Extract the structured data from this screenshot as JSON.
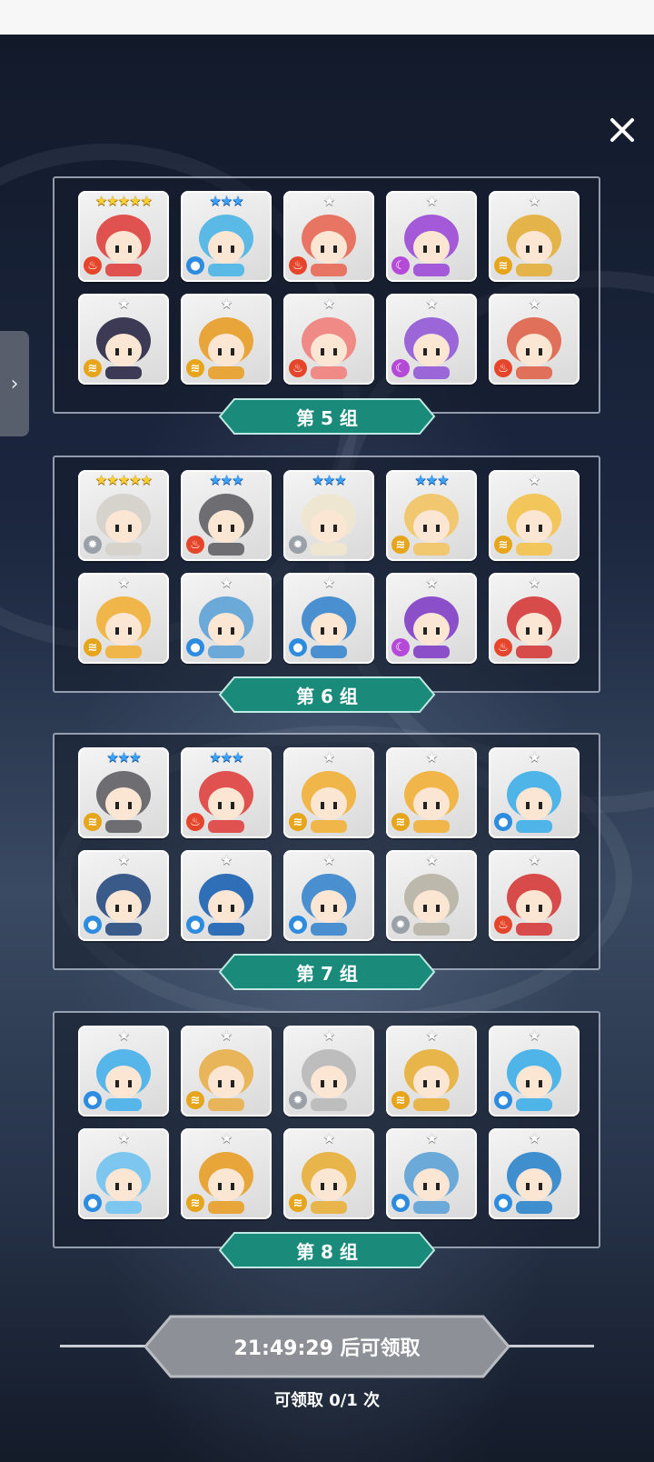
{
  "close_label": "✕",
  "side_tab_label": "›",
  "groups": [
    {
      "label": "第 5 组",
      "cards": [
        {
          "stars": "★★★★★",
          "tier": "gold",
          "element": "fire",
          "color": "#e0524f"
        },
        {
          "stars": "★★★",
          "tier": "blue",
          "element": "water",
          "color": "#5bb9e6"
        },
        {
          "stars": "★",
          "tier": "silver",
          "element": "fire",
          "color": "#e87564"
        },
        {
          "stars": "★",
          "tier": "silver",
          "element": "dark",
          "color": "#a45ad8"
        },
        {
          "stars": "★",
          "tier": "silver",
          "element": "wind",
          "color": "#e4b44b"
        },
        {
          "stars": "★",
          "tier": "silver",
          "element": "wind",
          "color": "#3c3a55"
        },
        {
          "stars": "★",
          "tier": "silver",
          "element": "wind",
          "color": "#e8a63a"
        },
        {
          "stars": "★",
          "tier": "silver",
          "element": "fire",
          "color": "#f08a86"
        },
        {
          "stars": "★",
          "tier": "silver",
          "element": "dark",
          "color": "#9a66d8"
        },
        {
          "stars": "★",
          "tier": "silver",
          "element": "fire",
          "color": "#e0705a"
        }
      ]
    },
    {
      "label": "第 6 组",
      "cards": [
        {
          "stars": "★★★★★",
          "tier": "gold",
          "element": "light",
          "color": "#d6d3cd"
        },
        {
          "stars": "★★★",
          "tier": "blue",
          "element": "fire",
          "color": "#6d6d72"
        },
        {
          "stars": "★★★",
          "tier": "blue",
          "element": "light",
          "color": "#efe6d2"
        },
        {
          "stars": "★★★",
          "tier": "blue",
          "element": "wind",
          "color": "#f1c870"
        },
        {
          "stars": "★",
          "tier": "silver",
          "element": "wind",
          "color": "#f2c65a"
        },
        {
          "stars": "★",
          "tier": "silver",
          "element": "wind",
          "color": "#f0b64a"
        },
        {
          "stars": "★",
          "tier": "silver",
          "element": "water",
          "color": "#6aa9d8"
        },
        {
          "stars": "★",
          "tier": "silver",
          "element": "water",
          "color": "#4a8fcf"
        },
        {
          "stars": "★",
          "tier": "silver",
          "element": "dark",
          "color": "#8b4fc9"
        },
        {
          "stars": "★",
          "tier": "silver",
          "element": "fire",
          "color": "#d84b4b"
        }
      ]
    },
    {
      "label": "第 7 组",
      "cards": [
        {
          "stars": "★★★",
          "tier": "blue",
          "element": "wind",
          "color": "#6d6d72"
        },
        {
          "stars": "★★★",
          "tier": "blue",
          "element": "fire",
          "color": "#e0524f"
        },
        {
          "stars": "★",
          "tier": "silver",
          "element": "wind",
          "color": "#f0b64a"
        },
        {
          "stars": "★",
          "tier": "silver",
          "element": "wind",
          "color": "#f0b64a"
        },
        {
          "stars": "★",
          "tier": "silver",
          "element": "water",
          "color": "#4fb4e8"
        },
        {
          "stars": "★",
          "tier": "silver",
          "element": "water",
          "color": "#3a5a8a"
        },
        {
          "stars": "★",
          "tier": "silver",
          "element": "water",
          "color": "#2f6fb8"
        },
        {
          "stars": "★",
          "tier": "silver",
          "element": "water",
          "color": "#4a8fcf"
        },
        {
          "stars": "★",
          "tier": "silver",
          "element": "light",
          "color": "#bdb8ac"
        },
        {
          "stars": "★",
          "tier": "silver",
          "element": "fire",
          "color": "#d84b4b"
        }
      ]
    },
    {
      "label": "第 8 组",
      "cards": [
        {
          "stars": "★",
          "tier": "silver",
          "element": "water",
          "color": "#56b6ea"
        },
        {
          "stars": "★",
          "tier": "silver",
          "element": "wind",
          "color": "#e8b55a"
        },
        {
          "stars": "★",
          "tier": "silver",
          "element": "light",
          "color": "#bdbdbd"
        },
        {
          "stars": "★",
          "tier": "silver",
          "element": "wind",
          "color": "#e8b54a"
        },
        {
          "stars": "★",
          "tier": "silver",
          "element": "water",
          "color": "#4fb4e8"
        },
        {
          "stars": "★",
          "tier": "silver",
          "element": "water",
          "color": "#7cc6ef"
        },
        {
          "stars": "★",
          "tier": "silver",
          "element": "wind",
          "color": "#e8a63a"
        },
        {
          "stars": "★",
          "tier": "silver",
          "element": "wind",
          "color": "#e8b54a"
        },
        {
          "stars": "★",
          "tier": "silver",
          "element": "water",
          "color": "#6aa9d8"
        },
        {
          "stars": "★",
          "tier": "silver",
          "element": "water",
          "color": "#3f8fcf"
        }
      ]
    }
  ],
  "claim": {
    "button_label": "21:49:29 后可领取",
    "count_label": "可领取 0/1 次"
  },
  "colors": {
    "group_label_bg": "#1a8a7a",
    "claim_button_bg": "#8d9096"
  }
}
